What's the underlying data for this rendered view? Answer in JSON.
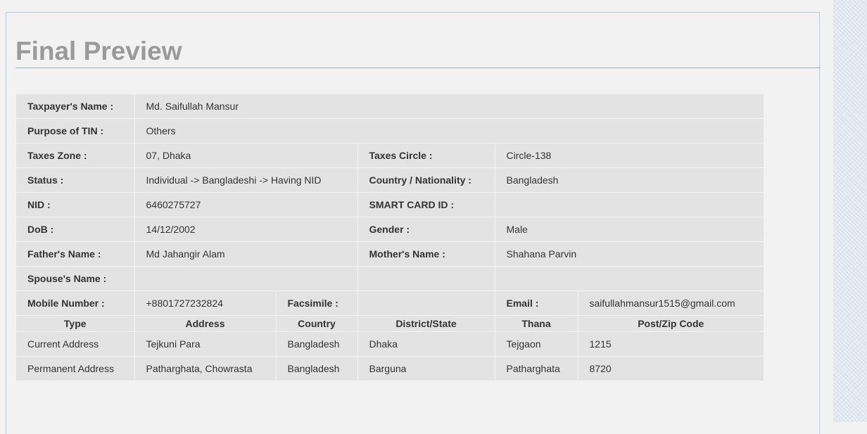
{
  "page": {
    "title": "Final Preview"
  },
  "taxpayer": {
    "label": "Taxpayer's Name :",
    "value": "Md. Saifullah Mansur"
  },
  "purpose": {
    "label": "Purpose of TIN :",
    "value": "Others"
  },
  "taxes_zone": {
    "label": "Taxes Zone :",
    "value": "07, Dhaka"
  },
  "taxes_circle": {
    "label": "Taxes Circle :",
    "value": "Circle-138"
  },
  "status": {
    "label": "Status :",
    "value": "Individual -> Bangladeshi -> Having NID"
  },
  "country_nationality": {
    "label": "Country / Nationality :",
    "value": "Bangladesh"
  },
  "nid": {
    "label": "NID :",
    "value": "6460275727"
  },
  "smart_card": {
    "label": "SMART CARD ID :",
    "value": ""
  },
  "dob": {
    "label": "DoB :",
    "value": "14/12/2002"
  },
  "gender": {
    "label": "Gender :",
    "value": "Male"
  },
  "father": {
    "label": "Father's Name :",
    "value": "Md Jahangir Alam"
  },
  "mother": {
    "label": "Mother's Name :",
    "value": "Shahana Parvin"
  },
  "spouse": {
    "label": "Spouse's Name :",
    "value": ""
  },
  "mobile": {
    "label": "Mobile Number :",
    "value": "+8801727232824"
  },
  "facsimile": {
    "label": "Facsimile :",
    "value": ""
  },
  "email": {
    "label": "Email :",
    "value": "saifullahmansur1515@gmail.com"
  },
  "address_table": {
    "headers": [
      "Type",
      "Address",
      "Country",
      "District/State",
      "Thana",
      "Post/Zip Code"
    ],
    "rows": [
      [
        "Current Address",
        "Tejkuni Para",
        "Bangladesh",
        "Dhaka",
        "Tejgaon",
        "1215"
      ],
      [
        "Permanent Address",
        "Patharghata, Chowrasta",
        "Bangladesh",
        "Barguna",
        "Patharghata",
        "8720"
      ]
    ]
  }
}
